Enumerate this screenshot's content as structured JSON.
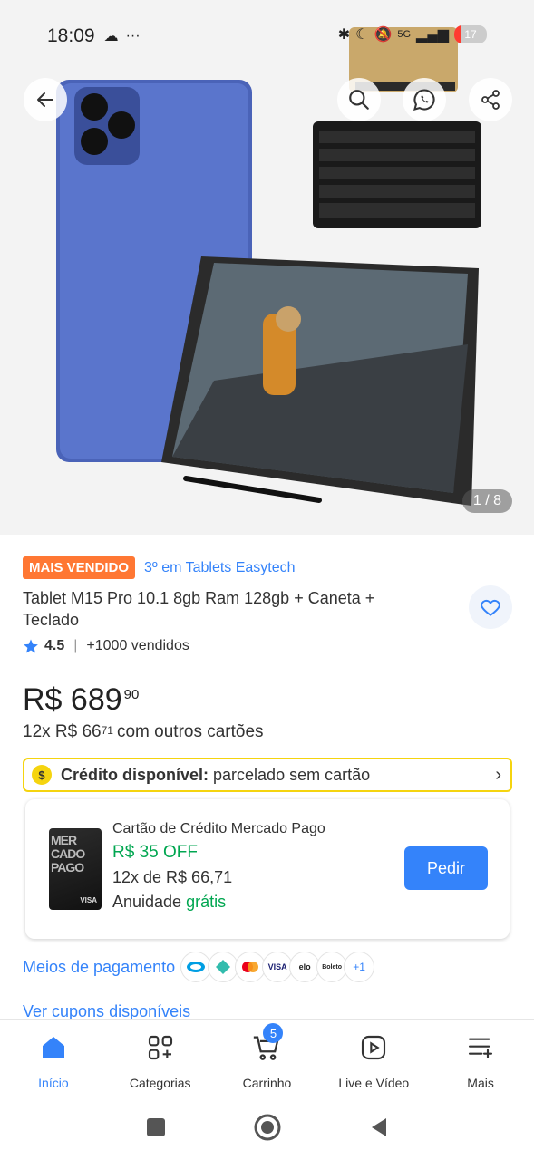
{
  "status_bar": {
    "time": "18:09",
    "battery": "17",
    "network": "5G"
  },
  "gallery": {
    "counter": "1 / 8"
  },
  "product": {
    "badge": "MAIS VENDIDO",
    "rank": "3º em Tablets Easytech",
    "title": "Tablet M15 Pro 10.1  8gb Ram 128gb + Caneta + Teclado",
    "rating": "4.5",
    "sold": "+1000 vendidos",
    "price_main": "R$ 689",
    "price_cents": "90",
    "installments_prefix": "12x R$ 66",
    "installments_cents": "71",
    "installments_suffix": "com outros cartões"
  },
  "credit": {
    "bold": "Crédito disponível:",
    "text": " parcelado sem cartão",
    "coin_symbol": "$"
  },
  "card_offer": {
    "card_text": "MER CADO PAGO",
    "card_brand": "VISA",
    "title": "Cartão de Crédito Mercado Pago",
    "off": "R$ 35 OFF",
    "installments": "12x de R$ 66,71",
    "fee_label": "Anuidade ",
    "fee_value": "grátis",
    "button": "Pedir"
  },
  "payments": {
    "label": "Meios de pagamento",
    "icons": [
      "mercadopago-icon",
      "pix-icon",
      "mastercard-icon",
      "VISA",
      "elo",
      "Boleto"
    ],
    "more": "+1"
  },
  "coupons": "Ver cupons disponíveis",
  "bottom_nav": {
    "items": [
      {
        "label": "Início"
      },
      {
        "label": "Categorias"
      },
      {
        "label": "Carrinho",
        "badge": "5"
      },
      {
        "label": "Live e Vídeo"
      },
      {
        "label": "Mais"
      }
    ]
  },
  "colors": {
    "accent": "#3483fa",
    "badge_orange": "#ff7733",
    "green": "#00a650",
    "yellow": "#f5d40f"
  }
}
